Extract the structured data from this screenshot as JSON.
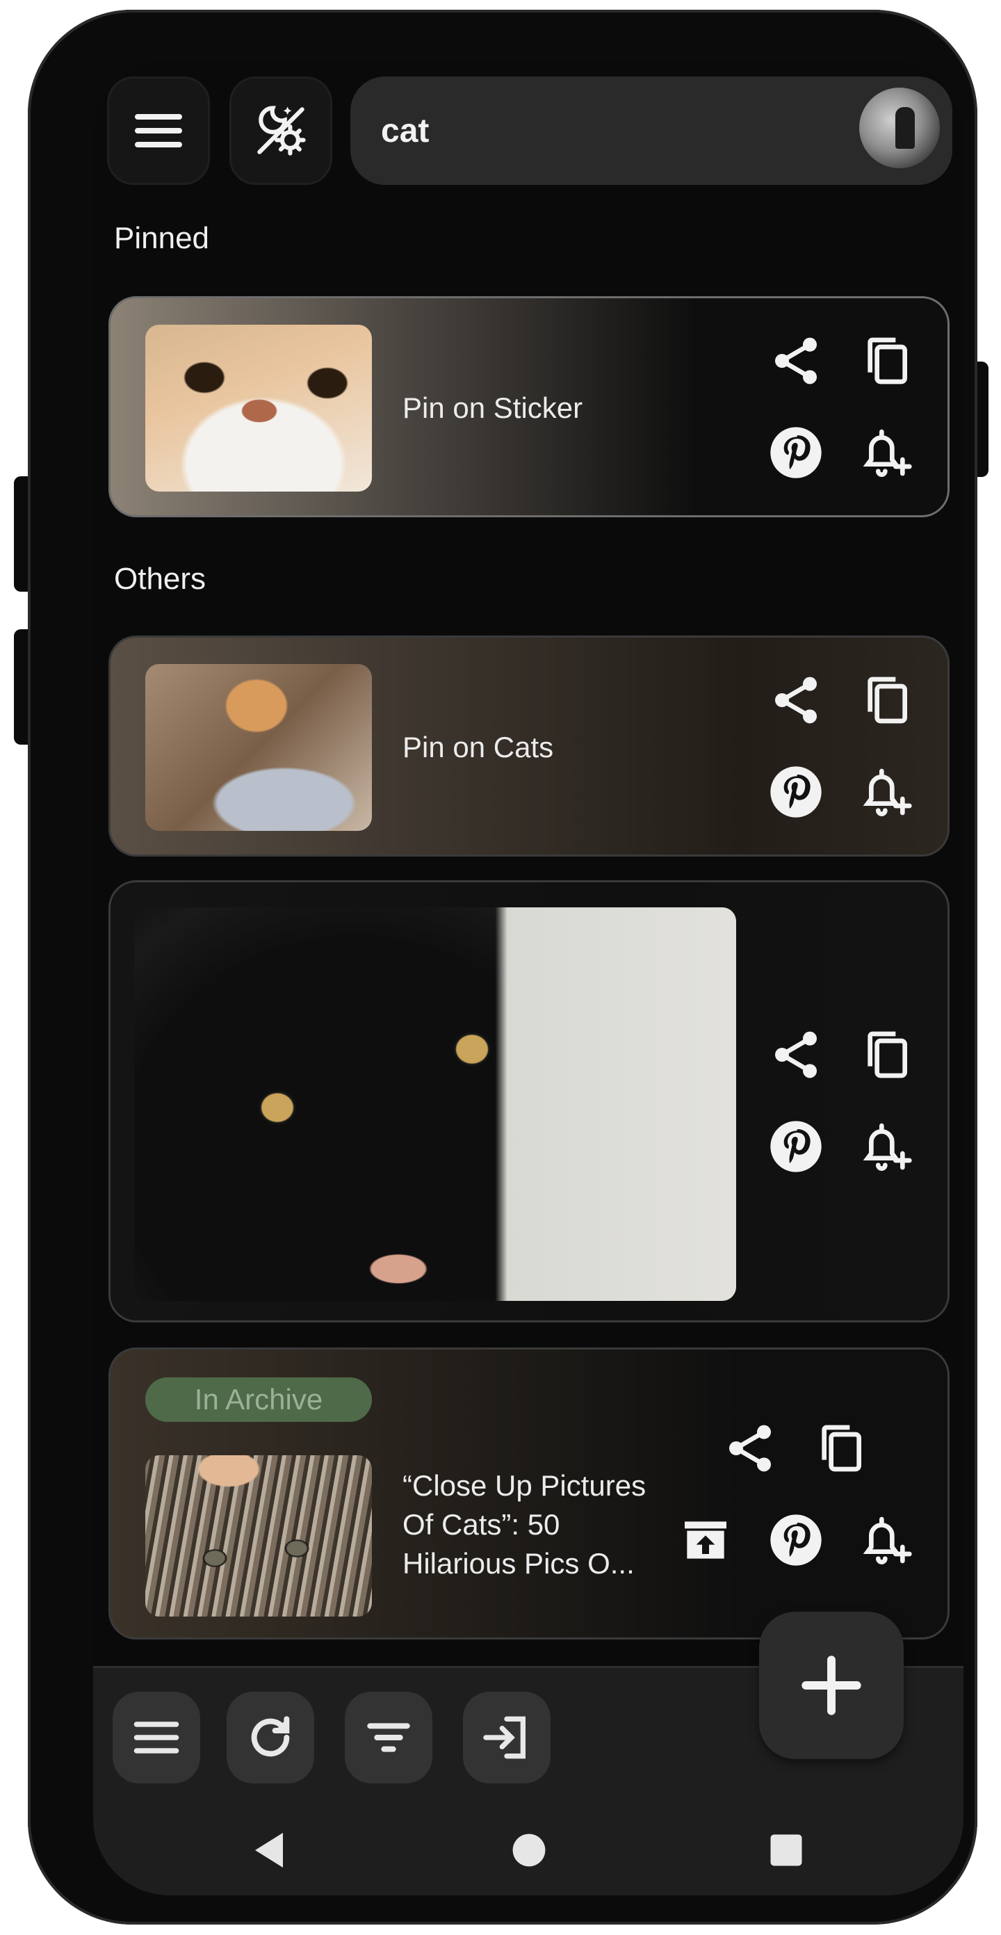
{
  "search": {
    "query": "cat"
  },
  "sections": {
    "pinned_label": "Pinned",
    "others_label": "Others"
  },
  "cards": [
    {
      "title": "Pin on Sticker"
    },
    {
      "title": "Pin on Cats"
    },
    {
      "title": ""
    },
    {
      "title": "“Close Up Pictures Of Cats”: 50 Hilarious Pics O...",
      "badge": "In Archive"
    }
  ],
  "icons": {
    "menu": "menu-icon",
    "theme": "theme-toggle-icon",
    "share": "share-icon",
    "copy": "copy-icon",
    "pinterest": "pinterest-icon",
    "reminder": "add-alarm-icon",
    "unarchive": "unarchive-icon",
    "refresh": "refresh-icon",
    "filter": "filter-icon",
    "login": "login-icon",
    "add": "plus-icon"
  },
  "colors": {
    "badge_bg": "#4f6a48",
    "badge_text": "#9ab294",
    "surface": "#0a0a0a"
  }
}
